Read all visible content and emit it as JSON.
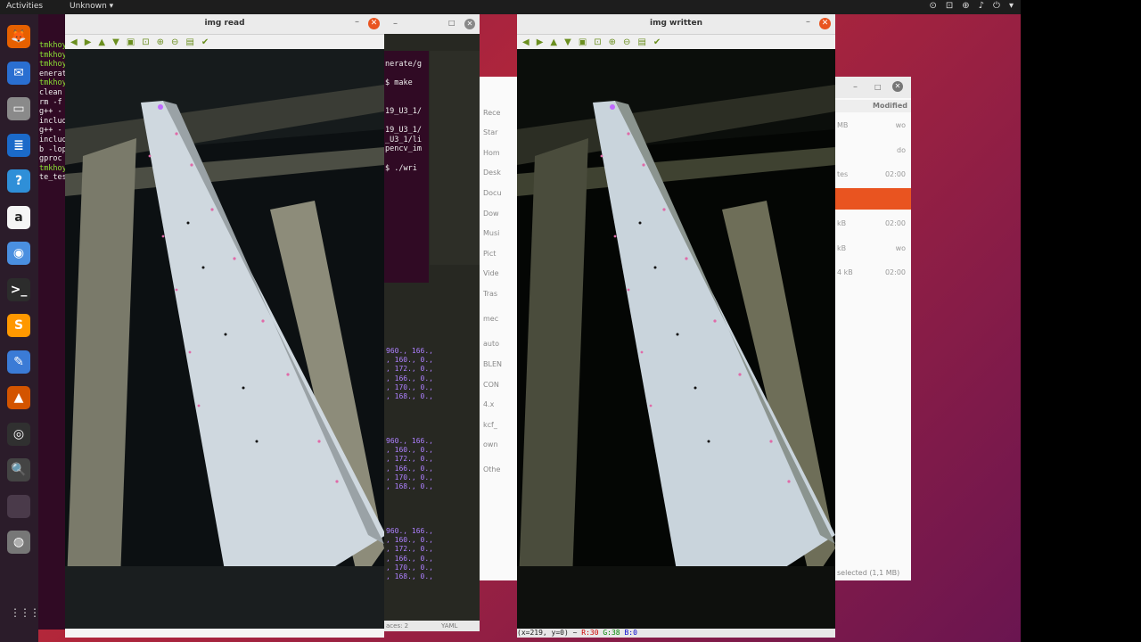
{
  "topbar": {
    "activities": "Activities",
    "app_menu": "Unknown ▾",
    "tray": [
      "⊙",
      "⊡",
      "⊕",
      "♪",
      "⏻",
      "▾"
    ]
  },
  "dock": {
    "apps": [
      {
        "name": "firefox-icon",
        "glyph": "🦊",
        "bg": "#e66000"
      },
      {
        "name": "thunderbird-icon",
        "glyph": "✉",
        "bg": "#2a6fd1"
      },
      {
        "name": "files-icon",
        "glyph": "▭",
        "bg": "#8a8a8a"
      },
      {
        "name": "writer-icon",
        "glyph": "≣",
        "bg": "#1b6ac9"
      },
      {
        "name": "help-icon",
        "glyph": "?",
        "bg": "#2f8fd8"
      },
      {
        "name": "amazon-icon",
        "glyph": "a",
        "bg": "#f5f5f5"
      },
      {
        "name": "chromium-icon",
        "glyph": "◉",
        "bg": "#4a8fe0"
      },
      {
        "name": "terminal-icon",
        "glyph": ">_",
        "bg": "#2c2c2c"
      },
      {
        "name": "sublime-icon",
        "glyph": "S",
        "bg": "#ff9800"
      },
      {
        "name": "text-editor-icon",
        "glyph": "✎",
        "bg": "#3b7bd6"
      },
      {
        "name": "matlab-icon",
        "glyph": "▲",
        "bg": "#d35400"
      },
      {
        "name": "obs-icon",
        "glyph": "◎",
        "bg": "#303030"
      },
      {
        "name": "search-icon",
        "glyph": "🔍",
        "bg": "#444"
      },
      {
        "name": "blank-app-icon",
        "glyph": "",
        "bg": "#4a3a4a"
      },
      {
        "name": "disk-icon",
        "glyph": "◍",
        "bg": "#777"
      }
    ],
    "show_apps": "⋮⋮⋮"
  },
  "terminal_left": {
    "lines": [
      "tmkhoy",
      "tmkhoy",
      "tmkhoy",
      "enerat",
      "tmkhoy",
      "clean",
      "rm -f",
      "g++ -",
      "includ",
      "g++ -",
      "includ",
      "b -lop",
      "gproc",
      "tmkhoy",
      "te_tes"
    ]
  },
  "img_read": {
    "title": "img read",
    "min": "–",
    "close": "✕"
  },
  "img_written": {
    "title": "img written",
    "min": "–",
    "close": "✕",
    "status": {
      "pos": "(x=219, y=0) ~ ",
      "r": "R:30",
      "g": "G:38",
      "b": "B:0"
    }
  },
  "toolbar_icons": [
    "◀",
    "▶",
    "▲",
    "▼",
    "▣",
    "⊡",
    "⊕",
    "⊖",
    "▤",
    "✔"
  ],
  "hidden_window": {
    "min": "–",
    "max": "□",
    "close": "✕"
  },
  "editor": {
    "term_lines": [
      "nerate/g",
      "",
      "$ make",
      "",
      "",
      "19_U3_1/",
      "",
      "19_U3_1/",
      "_U3_1/li",
      "pencv_im",
      "",
      "$ ./wri"
    ],
    "block": [
      "960., 166.,",
      ", 160., 0.,",
      ", 172., 0.,",
      ", 166., 0.,",
      ", 170., 0.,",
      ", 168., 0.,"
    ],
    "status_left": "aces: 2",
    "status_right": "YAML"
  },
  "filemgr": {
    "items": [
      "Rece",
      "Star",
      "Hom",
      "Desk",
      "Docu",
      "Dow",
      "Musi",
      "Pict",
      "Vide",
      "Tras",
      "mec",
      "auto",
      "BLEN",
      "CON",
      "4.x",
      "kcf_",
      "own",
      "Othe"
    ]
  },
  "files_right": {
    "header": "Modified",
    "rows": [
      {
        "size": "MB",
        "date": "wo"
      },
      {
        "size": "",
        "date": "do"
      },
      {
        "size": "tes",
        "date": "02:00"
      },
      {
        "size": "",
        "date": ""
      },
      {
        "size": "kB",
        "date": "02:00"
      },
      {
        "size": "kB",
        "date": "wo"
      },
      {
        "size": "4 kB",
        "date": "02:00"
      }
    ],
    "footer": "selected (1,1 MB)",
    "accent": "#e95420"
  }
}
